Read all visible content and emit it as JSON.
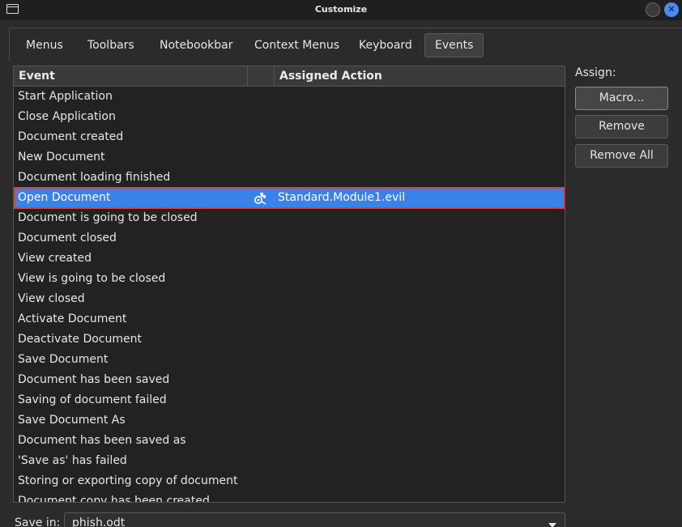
{
  "window": {
    "title": "Customize",
    "icon": "window-icon",
    "controls": [
      "minimize-icon",
      "close-icon"
    ]
  },
  "tabs": [
    {
      "label": "Menus",
      "active": false
    },
    {
      "label": "Toolbars",
      "active": false
    },
    {
      "label": "Notebookbar",
      "active": false
    },
    {
      "label": "Context Menus",
      "active": false
    },
    {
      "label": "Keyboard",
      "active": false
    },
    {
      "label": "Events",
      "active": true
    }
  ],
  "table": {
    "columns": {
      "event": "Event",
      "action": "Assigned Action"
    },
    "rows": [
      {
        "event": "Start Application",
        "action": ""
      },
      {
        "event": "Close Application",
        "action": ""
      },
      {
        "event": "Document created",
        "action": ""
      },
      {
        "event": "New Document",
        "action": ""
      },
      {
        "event": "Document loading finished",
        "action": ""
      },
      {
        "event": "Open Document",
        "action": "Standard.Module1.evil",
        "selected": true,
        "action_icon": "macro-icon"
      },
      {
        "event": "Document is going to be closed",
        "action": ""
      },
      {
        "event": "Document closed",
        "action": ""
      },
      {
        "event": "View created",
        "action": ""
      },
      {
        "event": "View is going to be closed",
        "action": ""
      },
      {
        "event": "View closed",
        "action": ""
      },
      {
        "event": "Activate Document",
        "action": ""
      },
      {
        "event": "Deactivate Document",
        "action": ""
      },
      {
        "event": "Save Document",
        "action": ""
      },
      {
        "event": "Document has been saved",
        "action": ""
      },
      {
        "event": "Saving of document failed",
        "action": ""
      },
      {
        "event": "Save Document As",
        "action": ""
      },
      {
        "event": "Document has been saved as",
        "action": ""
      },
      {
        "event": "'Save as' has failed",
        "action": ""
      },
      {
        "event": "Storing or exporting copy of document",
        "action": ""
      },
      {
        "event": "Document copy has been created",
        "action": ""
      }
    ]
  },
  "assign": {
    "label": "Assign:",
    "macro": "Macro...",
    "remove": "Remove",
    "remove_all": "Remove All"
  },
  "save_in": {
    "label": "Save in:",
    "value": "phish.odt"
  },
  "colors": {
    "selection": "#3b82e8",
    "highlight_border": "#e0403d",
    "close_button": "#4a8bf0"
  }
}
